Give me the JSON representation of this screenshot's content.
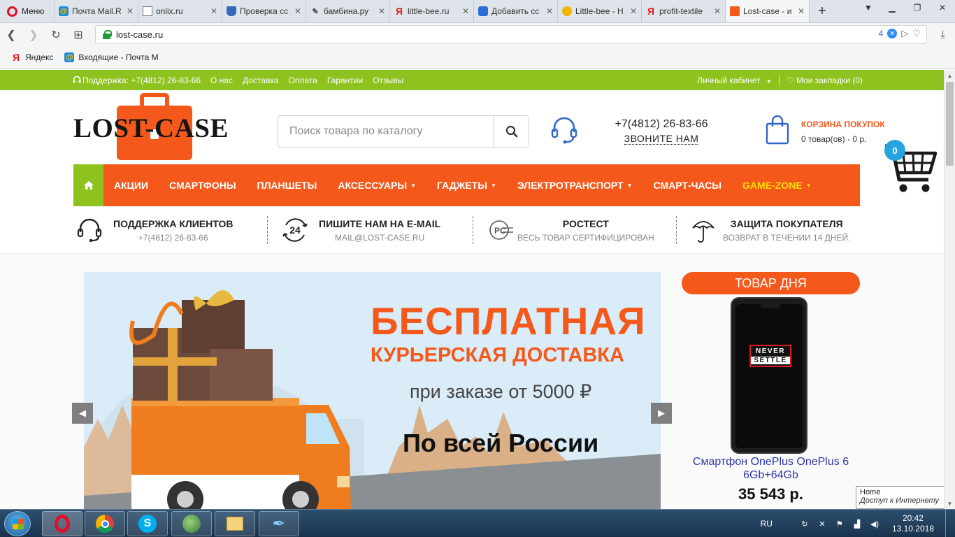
{
  "browser": {
    "menu_label": "Меню",
    "tabs": [
      {
        "label": "Почта Mail.R",
        "icon": "mail-icon"
      },
      {
        "label": "onlix.ru",
        "icon": "page-icon"
      },
      {
        "label": "Проверка сс",
        "icon": "shield-icon"
      },
      {
        "label": "бамбина.ру",
        "icon": "pen-icon"
      },
      {
        "label": "little-bee.ru",
        "icon": "yandex-icon"
      },
      {
        "label": "Добавить сс",
        "icon": "speech-bubble-icon"
      },
      {
        "label": "Little-bee - Н",
        "icon": "bee-icon"
      },
      {
        "label": "profit-textile",
        "icon": "yandex-icon"
      },
      {
        "label": "Lost-case - и",
        "icon": "suitcase-icon"
      }
    ],
    "url": "lost-case.ru",
    "adblock_count": "4",
    "bookmarks": [
      {
        "label": "Яндекс",
        "icon": "yandex-icon"
      },
      {
        "label": "Входящие - Почта М",
        "icon": "mail-icon"
      }
    ]
  },
  "site": {
    "topbar": {
      "support": "Поддержка: +7(4812) 26-83-66",
      "links": [
        "О нас",
        "Доставка",
        "Оплата",
        "Гарантии",
        "Отзывы"
      ],
      "account": "Личный кабинет",
      "bookmarks": "Мои закладки (0)"
    },
    "logo_text": "LOST-CASE",
    "search_placeholder": "Поиск товара по каталогу",
    "phone": "+7(4812) 26-83-66",
    "call_us": "ЗВОНИТЕ НАМ",
    "cart": {
      "title": "КОРЗИНА ПОКУПОК",
      "info": "0 товар(ов) - 0 р.",
      "count": "0"
    },
    "nav": {
      "akcii": "АКЦИИ",
      "smartphones": "СМАРТФОНЫ",
      "tablets": "ПЛАНШЕТЫ",
      "accessories": "АКСЕССУАРЫ",
      "gadgets": "ГАДЖЕТЫ",
      "electro": "ЭЛЕКТРОТРАНСПОРТ",
      "watches": "СМАРТ-ЧАСЫ",
      "game": "GAME-ZONE"
    },
    "features": [
      {
        "title": "ПОДДЕРЖКА КЛИЕНТОВ",
        "sub": "+7(4812) 26-83-66"
      },
      {
        "title": "ПИШИТЕ НАМ НА E-MAIL",
        "sub": "MAIL@LOST-CASE.RU"
      },
      {
        "title": "РОСТЕСТ",
        "sub": "ВЕСЬ ТОВАР СЕРТИФИЦИРОВАН"
      },
      {
        "title": "ЗАЩИТА ПОКУПАТЕЛЯ",
        "sub": "ВОЗВРАТ В ТЕЧЕНИИ 14 ДНЕЙ."
      }
    ],
    "banner": {
      "line1": "БЕСПЛАТНАЯ",
      "line2": "КУРЬЕРСКАЯ ДОСТАВКА",
      "line3": "при заказе от 5000 ₽",
      "line4": "По всей России"
    },
    "deal": {
      "title": "ТОВАР ДНЯ",
      "screen_top": "NEVER",
      "screen_bottom": "SETTLE",
      "name": "Смартфон OnePlus OnePlus 6 6Gb+64Gb",
      "price": "35 543 р."
    }
  },
  "status_tooltip": {
    "title": "Home",
    "subtitle": "Доступ к Интернету"
  },
  "taskbar": {
    "lang": "RU",
    "time": "20:42",
    "date": "13.10.2018"
  }
}
